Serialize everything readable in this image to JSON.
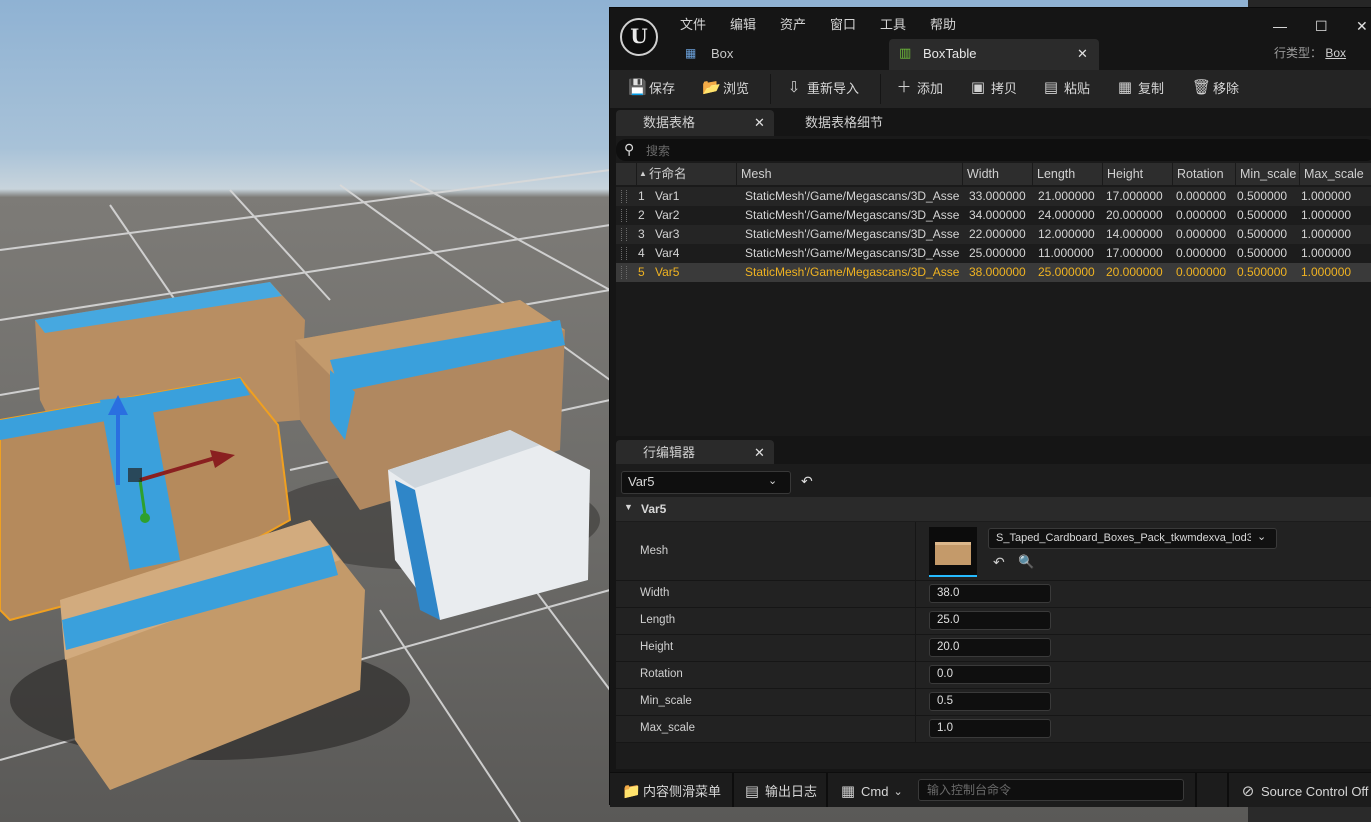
{
  "menu": [
    "文件",
    "编辑",
    "资产",
    "窗口",
    "工具",
    "帮助"
  ],
  "tabs": [
    {
      "label": "Box",
      "icon": "blueprint-icon"
    },
    {
      "label": "BoxTable",
      "icon": "data-table-icon"
    }
  ],
  "row_type": {
    "label": "行类型：",
    "value": "Box"
  },
  "toolbar": {
    "save": "保存",
    "browse": "浏览",
    "reimport": "重新导入",
    "add": "添加",
    "copy": "拷贝",
    "paste": "粘贴",
    "duplicate": "复制",
    "remove": "移除"
  },
  "panel_tabs": {
    "data_table": "数据表格",
    "details": "数据表格细节",
    "row_editor": "行编辑器"
  },
  "search_placeholder": "搜索",
  "columns": [
    "行命名",
    "Mesh",
    "Width",
    "Length",
    "Height",
    "Rotation",
    "Min_scale",
    "Max_scale"
  ],
  "rows": [
    {
      "n": "1",
      "name": "Var1",
      "mesh": "StaticMesh'/Game/Megascans/3D_Asse",
      "width": "33.000000",
      "length": "21.000000",
      "height": "17.000000",
      "rotation": "0.000000",
      "min": "0.500000",
      "max": "1.000000"
    },
    {
      "n": "2",
      "name": "Var2",
      "mesh": "StaticMesh'/Game/Megascans/3D_Asse",
      "width": "34.000000",
      "length": "24.000000",
      "height": "20.000000",
      "rotation": "0.000000",
      "min": "0.500000",
      "max": "1.000000"
    },
    {
      "n": "3",
      "name": "Var3",
      "mesh": "StaticMesh'/Game/Megascans/3D_Asse",
      "width": "22.000000",
      "length": "12.000000",
      "height": "14.000000",
      "rotation": "0.000000",
      "min": "0.500000",
      "max": "1.000000"
    },
    {
      "n": "4",
      "name": "Var4",
      "mesh": "StaticMesh'/Game/Megascans/3D_Asse",
      "width": "25.000000",
      "length": "11.000000",
      "height": "17.000000",
      "rotation": "0.000000",
      "min": "0.500000",
      "max": "1.000000"
    },
    {
      "n": "5",
      "name": "Var5",
      "mesh": "StaticMesh'/Game/Megascans/3D_Asse",
      "width": "38.000000",
      "length": "25.000000",
      "height": "20.000000",
      "rotation": "0.000000",
      "min": "0.500000",
      "max": "1.000000"
    }
  ],
  "row_editor": {
    "selected": "Var5",
    "category": "Var5",
    "mesh_label": "Mesh",
    "mesh_value": "S_Taped_Cardboard_Boxes_Pack_tkwmdexva_lod3_",
    "props": [
      {
        "label": "Width",
        "value": "38.0"
      },
      {
        "label": "Length",
        "value": "25.0"
      },
      {
        "label": "Height",
        "value": "20.0"
      },
      {
        "label": "Rotation",
        "value": "0.0"
      },
      {
        "label": "Min_scale",
        "value": "0.5"
      },
      {
        "label": "Max_scale",
        "value": "1.0"
      }
    ]
  },
  "statusbar": {
    "content_drawer": "内容侧滑菜单",
    "output_log": "输出日志",
    "cmd": "Cmd",
    "cmd_placeholder": "输入控制台命令",
    "source_control": "Source Control Off"
  },
  "colors": {
    "selected_row_text": "#f0b321",
    "accent": "#26bbff"
  }
}
